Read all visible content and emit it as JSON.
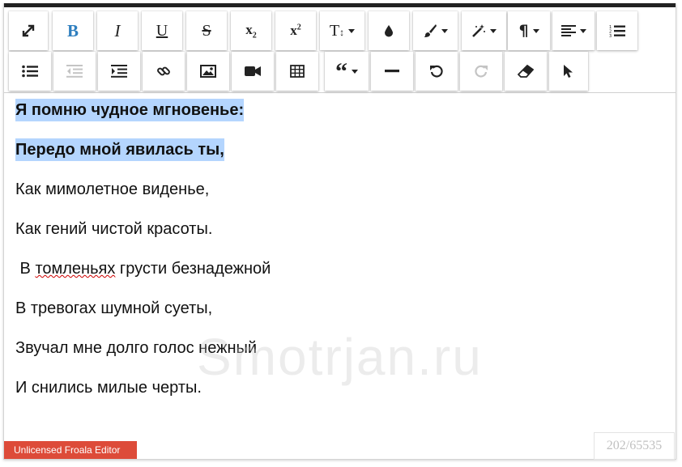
{
  "toolbar": {
    "row1": [
      {
        "name": "fullscreen-button",
        "icon": "expand-icon"
      },
      {
        "name": "bold-button",
        "icon": "bold-icon",
        "label": "B"
      },
      {
        "name": "italic-button",
        "icon": "italic-icon",
        "label": "I"
      },
      {
        "name": "underline-button",
        "icon": "underline-icon",
        "label": "U"
      },
      {
        "name": "strikethrough-button",
        "icon": "strikethrough-icon",
        "label": "S"
      },
      {
        "name": "subscript-button",
        "icon": "subscript-icon",
        "label": "x",
        "sub": "2"
      },
      {
        "name": "superscript-button",
        "icon": "superscript-icon",
        "label": "x",
        "sup": "2"
      },
      {
        "name": "font-size-button",
        "icon": "font-size-icon",
        "label": "T"
      },
      {
        "name": "color-button",
        "icon": "droplet-icon"
      },
      {
        "name": "paragraph-style-button",
        "icon": "brush-icon"
      },
      {
        "name": "inline-style-button",
        "icon": "magic-wand-icon"
      },
      {
        "name": "paragraph-format-button",
        "icon": "pilcrow-icon",
        "label": "¶"
      },
      {
        "name": "align-button",
        "icon": "align-left-icon"
      },
      {
        "name": "ordered-list-button",
        "icon": "ordered-list-icon"
      }
    ],
    "row2": [
      {
        "name": "unordered-list-button",
        "icon": "unordered-list-icon"
      },
      {
        "name": "outdent-button",
        "icon": "outdent-icon",
        "disabled": true
      },
      {
        "name": "indent-button",
        "icon": "indent-icon"
      },
      {
        "name": "insert-link-button",
        "icon": "link-icon"
      },
      {
        "name": "insert-image-button",
        "icon": "image-icon"
      },
      {
        "name": "insert-video-button",
        "icon": "video-camera-icon"
      },
      {
        "name": "insert-table-button",
        "icon": "table-icon"
      },
      {
        "name": "quote-button",
        "icon": "quote-icon"
      },
      {
        "name": "insert-hr-button",
        "icon": "horizontal-rule-icon"
      },
      {
        "name": "undo-button",
        "icon": "undo-icon"
      },
      {
        "name": "redo-button",
        "icon": "redo-icon",
        "disabled": true
      },
      {
        "name": "clear-formatting-button",
        "icon": "eraser-icon"
      },
      {
        "name": "select-all-button",
        "icon": "cursor-icon"
      }
    ]
  },
  "content": {
    "lines": [
      "Я помню чудное мгновенье:",
      "Передо мной явилась ты,",
      "Как мимолетное виденье,",
      "Как гений чистой красоты.",
      " В ",
      "томленьях",
      " грусти безнадежной",
      "В тревогах шумной суеты,",
      "Звучал мне долго голос нежный",
      "И снились милые черты."
    ]
  },
  "watermark": "Smotrjan.ru",
  "license_text": "Unlicensed Froala Editor",
  "char_counter": "202/65535",
  "colors": {
    "accent": "#2f7fbf",
    "highlight": "#b4d5fe",
    "license": "#dd4b39"
  }
}
